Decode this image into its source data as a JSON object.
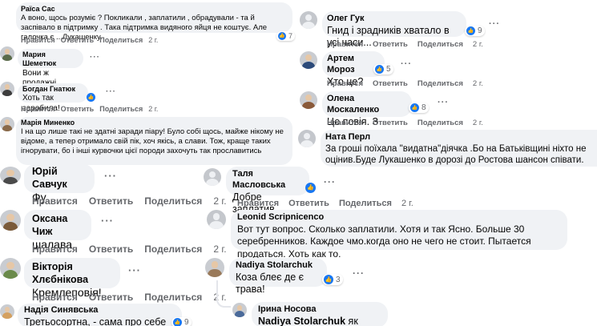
{
  "labels": {
    "like": "Нравится",
    "reply": "Ответить",
    "share": "Поделиться"
  },
  "comments": [
    {
      "author": "Раїса Сас",
      "text": "А воно, щось розуміє  ?  Покликали , заплатили , обрадували - та й заспівало в підтримку . Така підтримка видяного яйця не коштує. Але галочка є ...Лукашенку.",
      "time": "2 г.",
      "likes": "7"
    },
    {
      "author": "Мария Шеметюк",
      "text": "Вони ж продажні"
    },
    {
      "author": "Богдан Гнатюк",
      "text": "Хоть так заробила!",
      "time": "2 г."
    },
    {
      "author": "Марія Миненко",
      "text": "І на що лише такі не здатні заради піару! Було собі щось, майже нікому не відоме, а тепер отримало свій пік, хоч якісь, а слави. Тож, краще таких ігнорувати, бо і інші курвочки цієї породи захочуть так прославитись"
    },
    {
      "author": "Юрій Савчук",
      "text": "Фу",
      "time": "2 г."
    },
    {
      "author": "Оксана Чиж",
      "text": "шалава.",
      "time": "2 г."
    },
    {
      "author": "Вікторія Хлєбнікова",
      "text": "Кремлеповія!",
      "time": "2 г."
    },
    {
      "author": "Надія Синявська",
      "text": "Третьосортна, - сама про себе сказала.",
      "likes": "9"
    },
    {
      "author": "Олег Гук",
      "text": "Гнид і зрадників хватало в усі часи...",
      "time": "2 г.",
      "likes": "9"
    },
    {
      "author": "Артем Мороз",
      "text": "Хто це?",
      "time": "2 г.",
      "likes": "5"
    },
    {
      "author": "Олена Москаленко",
      "text": "Це повія. З окружної.",
      "time": "2 г.",
      "likes": "8"
    },
    {
      "author": "Ната Перл",
      "text": "За гроші поїхала \"видатна\"діячка .Бо на Батьківщині ніхто не оцінив.Буде Лукашенко в дорозі до Ростова шансон співати."
    },
    {
      "author": "Таля Масловська",
      "text": "Добре заплатив...",
      "time": "2 г."
    },
    {
      "author": "Leonid Scripnicenco",
      "text": "Вот тут вопрос. Сколько заплатили. Хотя и так Ясно. Больше 30 серебренников. Каждое чмо.когда оно не чего не стоит. Пытается продаться. Хоть как то."
    },
    {
      "author": "Nadiya Stolarchuk",
      "text": "Коза блеє де є трава!",
      "likes": "3"
    },
    {
      "author": "Ірина Носова",
      "mention": "Nadiya Stolarchuk",
      "text": " як влучно!!!"
    }
  ]
}
